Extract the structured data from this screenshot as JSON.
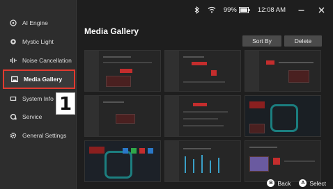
{
  "sidebar": {
    "items": [
      {
        "label": "AI Engine",
        "icon": "ai-engine-icon"
      },
      {
        "label": "Mystic Light",
        "icon": "mystic-light-icon"
      },
      {
        "label": "Noise Cancellation",
        "icon": "noise-cancellation-icon"
      },
      {
        "label": "Media Gallery",
        "icon": "media-gallery-icon",
        "active": true
      },
      {
        "label": "System Info",
        "icon": "system-info-icon"
      },
      {
        "label": "Service",
        "icon": "service-icon"
      },
      {
        "label": "General Settings",
        "icon": "gear-icon"
      }
    ]
  },
  "callout": {
    "number": "1"
  },
  "status": {
    "battery": "99%",
    "time": "12:08 AM"
  },
  "page": {
    "title": "Media Gallery"
  },
  "toolbar": {
    "sort_label": "Sort By",
    "delete_label": "Delete"
  },
  "footer": {
    "back_key": "B",
    "back_label": "Back",
    "select_key": "A",
    "select_label": "Select"
  },
  "colors": {
    "accent": "#e23a2f",
    "background": "#1e1e1e",
    "sidebar": "#2d2d2d",
    "button": "#4a4a4a"
  }
}
